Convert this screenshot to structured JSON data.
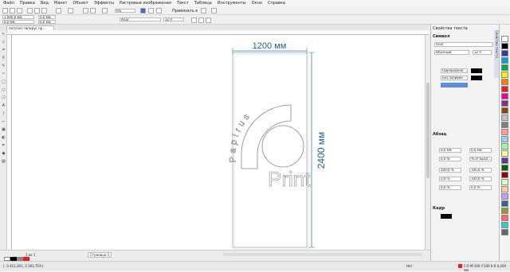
{
  "menu": [
    "Файл",
    "Правка",
    "Вид",
    "Макет",
    "Объект",
    "Эффекты",
    "Растровые изображения",
    "Текст",
    "Таблица",
    "Инструменты",
    "Окно",
    "Справка"
  ],
  "toolbar": {
    "zoom": "6%",
    "snap_label": "Привязать к"
  },
  "property_bar": {
    "x": "1 000,0 мм",
    "y": "0,0 мм",
    "w": "0,0 мм",
    "h": "0,0 мм",
    "font": "Arial",
    "size": "12 п"
  },
  "doc_tab": "логотип папирус пр...",
  "page_tab": "Страница 1",
  "page_counter": "1 из 1",
  "status_coords": "( -3 411,301; 2 203,719 )",
  "status_color": "C:0 M:100 Y:100 K:0  0,200 мм",
  "status_fill_label": "Нет",
  "design": {
    "width_label": "1200 мм",
    "height_label": "2400 мм",
    "logo_word_arc": "Papirus",
    "logo_word_print": "Print"
  },
  "docker": {
    "title": "Свойства текста",
    "section_char": "Символ",
    "font": "Arial",
    "style": "Обычный",
    "size": "12 п",
    "fill_type": "Однородная ...",
    "bg_type": "Без заливки",
    "section_para": "Абзац",
    "para_rows": [
      [
        "0,0 мм",
        "0,0 мм"
      ],
      [
        "0,0 %",
        "% от высо..."
      ],
      [
        "100,0 %",
        "100,0 %"
      ],
      [
        "0,0 %",
        "100,0 %"
      ],
      [
        "0,0 %",
        "0,0 %"
      ]
    ],
    "section_frame": "Кадр",
    "side_tab": "Свойства текста"
  },
  "palette_colors": [
    "#ffffff",
    "#000000",
    "#3a3a9c",
    "#00a0e3",
    "#00a650",
    "#fff200",
    "#ff7f00",
    "#ed1c24",
    "#ec008c",
    "#92278f",
    "#8b4513",
    "#c0c0c0",
    "#808080",
    "#ff9999",
    "#99ccff",
    "#99ff99",
    "#ffff99",
    "#663399",
    "#006600",
    "#990000",
    "#ccffcc",
    "#ffcc99",
    "#cc99ff",
    "#336699",
    "#999933",
    "#ff6666",
    "#33cccc",
    "#666666"
  ],
  "bottom_swatches": [
    "#ffffff",
    "#000000",
    "#888888",
    "#ed1c24"
  ]
}
